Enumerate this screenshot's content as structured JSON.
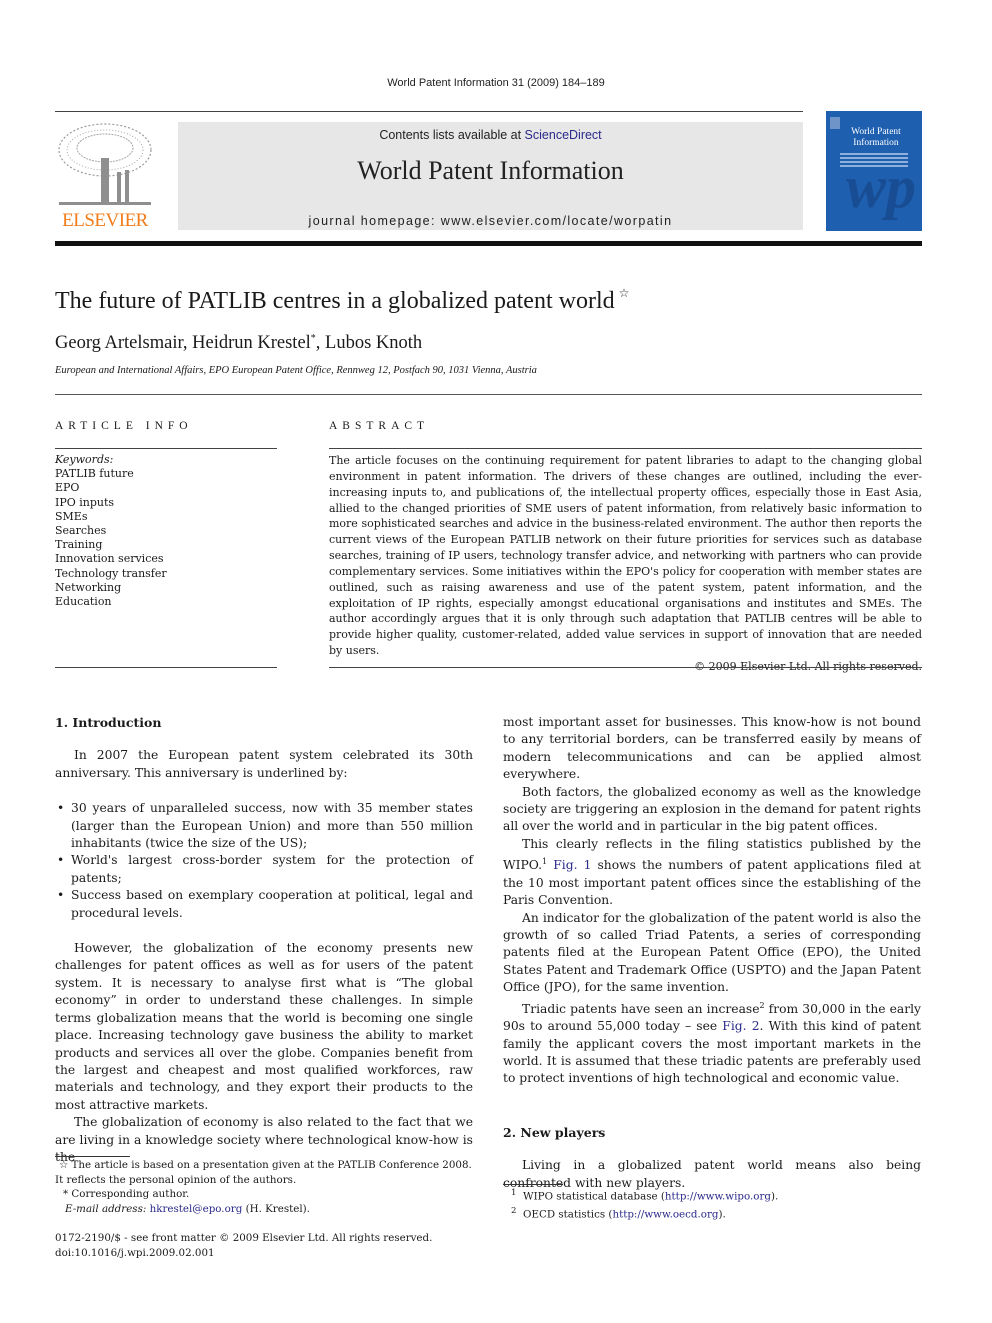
{
  "running_head": "World Patent Information 31 (2009) 184–189",
  "masthead": {
    "contents_prefix": "Contents lists available at ",
    "contents_link": "ScienceDirect",
    "journal_name": "World Patent Information",
    "homepage": "journal homepage: www.elsevier.com/locate/worpatin",
    "publisher_logo_text": "ELSEVIER",
    "cover_title": "World Patent Information",
    "cover_monogram": "wp"
  },
  "colors": {
    "publisher_orange": "#f07c1a",
    "cover_blue": "#1e5fb0",
    "masthead_gray": "#e7e7e7",
    "link_blue": "#2a2a8a"
  },
  "article": {
    "title": "The future of PATLIB centres in a globalized patent world",
    "title_marker": "☆",
    "authors": {
      "author1": "Georg Artelsmair, ",
      "author2": "Heidrun Krestel",
      "author2_marker": "*",
      "author3": ", Lubos Knoth"
    },
    "affiliation": "European and International Affairs, EPO European Patent Office, Rennweg 12, Postfach 90, 1031 Vienna, Austria"
  },
  "article_info": {
    "heading": "ARTICLE INFO",
    "keywords_label": "Keywords:",
    "keywords": [
      "PATLIB future",
      "EPO",
      "IPO inputs",
      "SMEs",
      "Searches",
      "Training",
      "Innovation services",
      "Technology transfer",
      "Networking",
      "Education"
    ]
  },
  "abstract": {
    "heading": "ABSTRACT",
    "text": "The article focuses on the continuing requirement for patent libraries to adapt to the changing global environment in patent information. The drivers of these changes are outlined, including the ever-increasing inputs to, and publications of, the intellectual property offices, especially those in East Asia, allied to the changed priorities of SME users of patent information, from relatively basic information to more sophisticated searches and advice in the business-related environment. The author then reports the current views of the European PATLIB network on their future priorities for services such as database searches, training of IP users, technology transfer advice, and networking with partners who can provide complementary services. Some initiatives within the EPO's policy for cooperation with member states are outlined, such as raising awareness and use of the patent system, patent information, and the exploitation of IP rights, especially amongst educational organisations and institutes and SMEs. The author accordingly argues that it is only through such adaptation that PATLIB centres will be able to provide higher quality, customer-related, added value services in support of innovation that are needed by users.",
    "copyright": "© 2009 Elsevier Ltd. All rights reserved."
  },
  "body": {
    "section1_heading": "1. Introduction",
    "p1": "In 2007 the European patent system celebrated its 30th anniversary. This anniversary is underlined by:",
    "bullets": [
      "30 years of unparalleled success, now with 35 member states (larger than the European Union) and more than 550 million inhabitants (twice the size of the US);",
      "World's largest cross-border system for the protection of patents;",
      "Success based on exemplary cooperation at political, legal and procedural levels."
    ],
    "p2": "However, the globalization of the economy presents new challenges for patent offices as well as for users of the patent system. It is necessary to analyse first what is “The global economy” in order to understand these challenges. In simple terms globalization means that the world is becoming one single place. Increasing technology gave business the ability to market products and services all over the globe. Companies benefit from the largest and cheapest and most qualified workforces, raw materials and technology, and they export their products to the most attractive markets.",
    "p3": "The globalization of economy is also related to the fact that we are living in a knowledge society where technological know-how is the",
    "p3_cont": "most important asset for businesses. This know-how is not bound to any territorial borders, can be transferred easily by means of modern telecommunications and can be applied almost everywhere.",
    "p4": "Both factors, the globalized economy as well as the knowledge society are triggering an explosion in the demand for patent rights all over the world and in particular in the big patent offices.",
    "p5_a": "This clearly reflects in the filing statistics published by the WIPO.",
    "p5_fn": "1",
    "p5_link": "Fig. 1",
    "p5_b": " shows the numbers of patent applications filed at the 10 most important patent offices since the establishing of the Paris Convention.",
    "p6": "An indicator for the globalization of the patent world is also the growth of so called Triad Patents, a series of corresponding patents filed at the European Patent Office (EPO), the United States Patent and Trademark Office (USPTO) and the Japan Patent Office (JPO), for the same invention.",
    "p7_a": "Triadic patents have seen an increase",
    "p7_fn": "2",
    "p7_b": " from 30,000 in the early 90s to around 55,000 today – see ",
    "p7_link": "Fig. 2",
    "p7_c": ". With this kind of patent family the applicant covers the most important markets in the world. It is assumed that these triadic patents are preferably used to protect inventions of high technological and economic value.",
    "section2_heading": "2. New players",
    "p8": "Living in a globalized patent world means also being confronted with new players."
  },
  "footnotes_left": {
    "star_marker": "☆",
    "star_text": " The article is based on a presentation given at the PATLIB Conference 2008. It reflects the personal opinion of the authors.",
    "corr_marker": "*",
    "corr_text": " Corresponding author.",
    "email_label": "E-mail address: ",
    "email": "hkrestel@epo.org",
    "email_suffix": " (H. Krestel)."
  },
  "front_matter": {
    "line1": "0172-2190/$ - see front matter © 2009 Elsevier Ltd. All rights reserved.",
    "doi": "doi:10.1016/j.wpi.2009.02.001"
  },
  "footnotes_right": [
    {
      "num": "1",
      "text": "WIPO statistical database (",
      "link": "http://www.wipo.org",
      "suffix": ")."
    },
    {
      "num": "2",
      "text": "OECD statistics (",
      "link": "http://www.oecd.org",
      "suffix": ")."
    }
  ]
}
